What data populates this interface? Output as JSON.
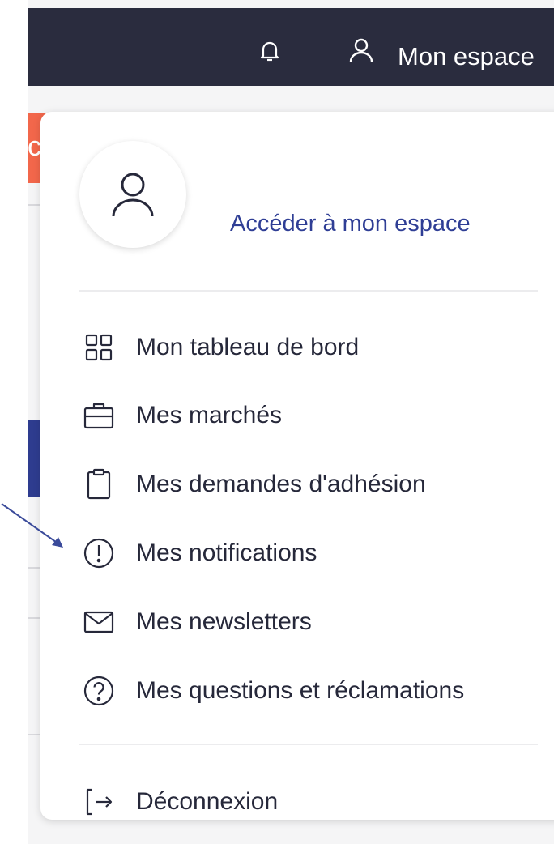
{
  "header": {
    "account_label": "Mon espace",
    "close_symbol": "×"
  },
  "background": {
    "orange_fragment": "c"
  },
  "account_menu": {
    "access_link": "Accéder à mon espace",
    "items": [
      {
        "label": "Mon tableau de bord",
        "icon": "grid-icon"
      },
      {
        "label": "Mes marchés",
        "icon": "briefcase-icon"
      },
      {
        "label": "Mes demandes d'adhésion",
        "icon": "clipboard-icon"
      },
      {
        "label": "Mes notifications",
        "icon": "alert-circle-icon"
      },
      {
        "label": "Mes newsletters",
        "icon": "mail-icon"
      },
      {
        "label": "Mes questions et réclamations",
        "icon": "question-circle-icon"
      }
    ],
    "logout_label": "Déconnexion"
  },
  "colors": {
    "topbar": "#2a2c3e",
    "link": "#2f3e95",
    "text": "#26283a",
    "annotation_arrow": "#3a4a9a",
    "orange": "#f2674b"
  }
}
